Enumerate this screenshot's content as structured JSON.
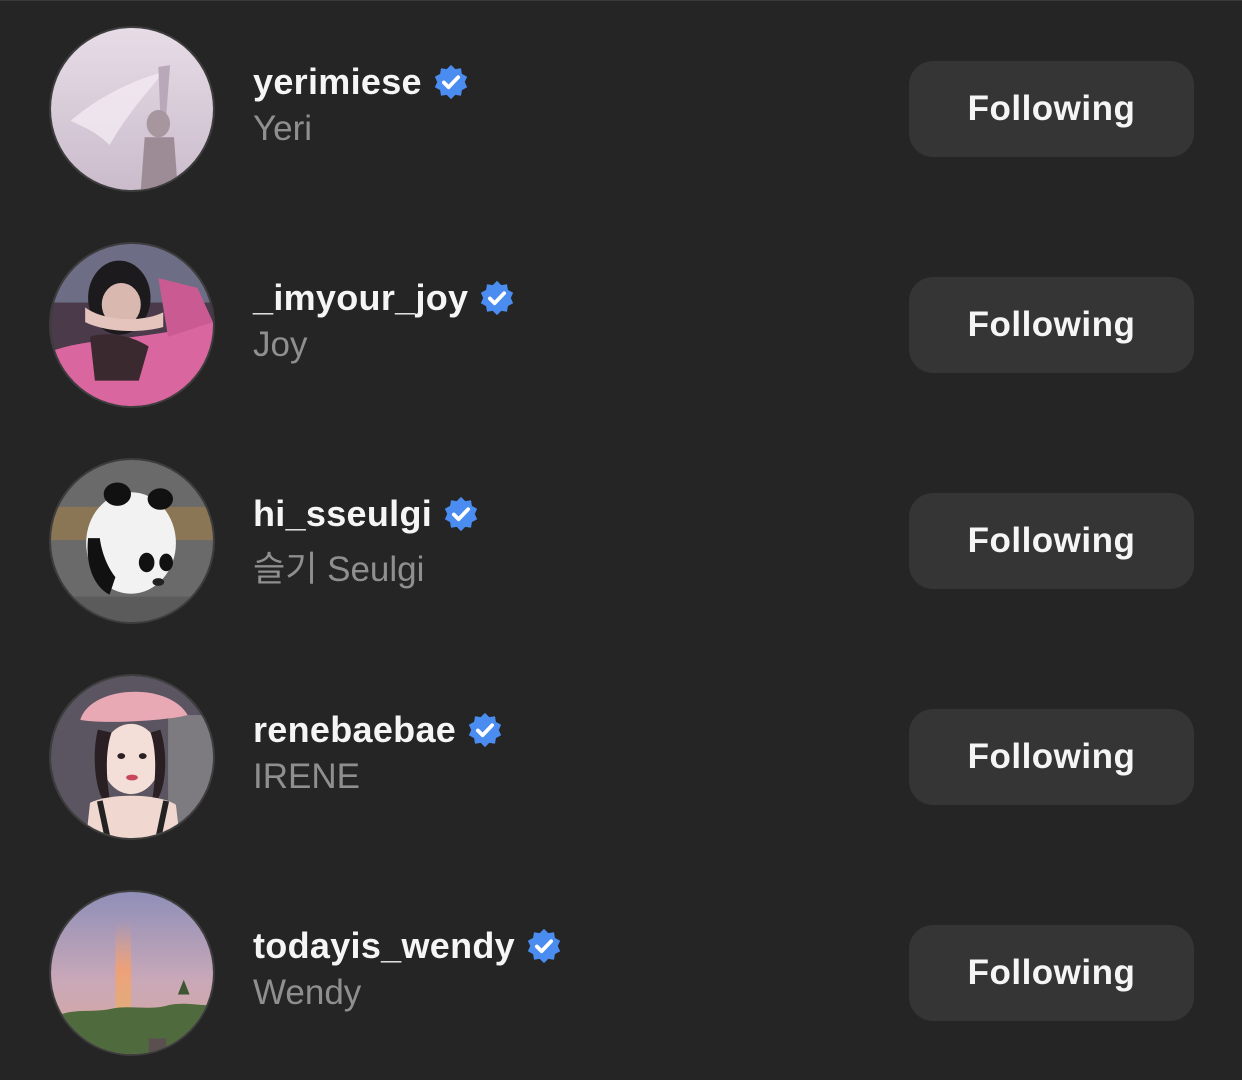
{
  "accent_badge_color": "#4a8cf0",
  "button_color": "#353535",
  "background_color": "#252525",
  "accounts": [
    {
      "username": "yerimiese",
      "full_name": "Yeri",
      "verified": true,
      "button_label": "Following",
      "avatar_icon": "avatar-photo"
    },
    {
      "username": "_imyour_joy",
      "full_name": "Joy",
      "verified": true,
      "button_label": "Following",
      "avatar_icon": "avatar-photo"
    },
    {
      "username": "hi_sseulgi",
      "full_name": "슬기 Seulgi",
      "verified": true,
      "button_label": "Following",
      "avatar_icon": "avatar-photo"
    },
    {
      "username": "renebaebae",
      "full_name": "IRENE",
      "verified": true,
      "button_label": "Following",
      "avatar_icon": "avatar-photo"
    },
    {
      "username": "todayis_wendy",
      "full_name": "Wendy",
      "verified": true,
      "button_label": "Following",
      "avatar_icon": "avatar-photo"
    }
  ]
}
